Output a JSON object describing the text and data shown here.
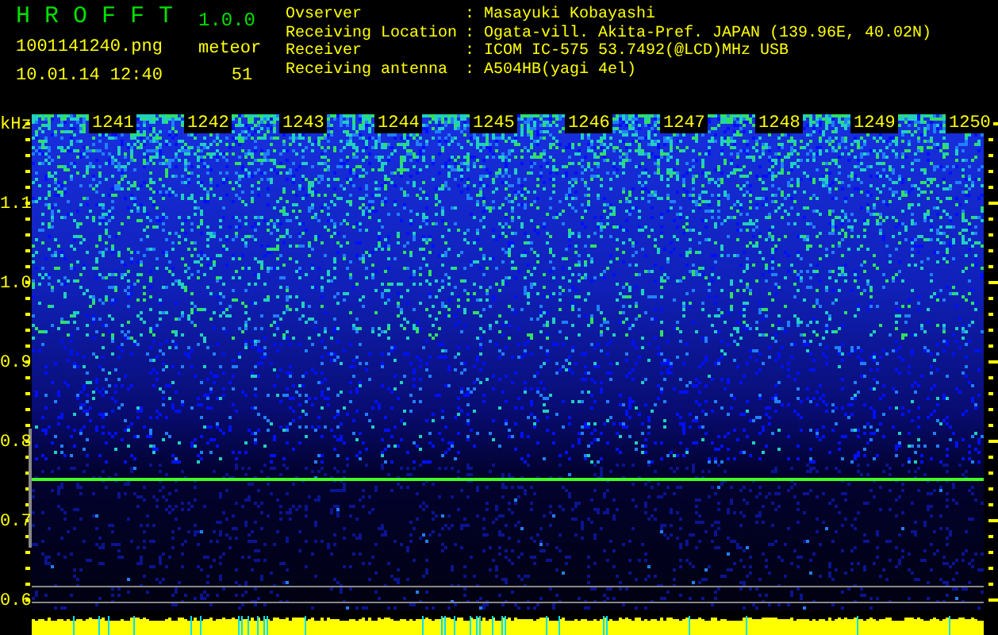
{
  "app": {
    "name": "H R O F F T",
    "version": "1.0.0"
  },
  "file": "1001141240.png",
  "timestamp": "10.01.14 12:40",
  "counter": {
    "label": "meteor",
    "value": "51"
  },
  "info": [
    {
      "label": "Ovserver",
      "separator": ":",
      "value": "Masayuki Kobayashi"
    },
    {
      "label": "Receiving Location",
      "separator": ":",
      "value": "Ogata-vill. Akita-Pref. JAPAN (139.96E, 40.02N)"
    },
    {
      "label": "Receiver",
      "separator": ":",
      "value": "ICOM IC-575 53.7492(@LCD)MHz USB"
    },
    {
      "label": "Receiving antenna",
      "separator": ":",
      "value": "A504HB(yagi 4el)"
    }
  ],
  "axis": {
    "unit": "kHz",
    "y_labels": [
      "1.1",
      "1.0",
      "0.9",
      "0.8",
      "0.7",
      "0.6"
    ],
    "time_labels": [
      "1241",
      "1242",
      "1243",
      "1244",
      "1245",
      "1246",
      "1247",
      "1248",
      "1249",
      "1250"
    ]
  }
}
